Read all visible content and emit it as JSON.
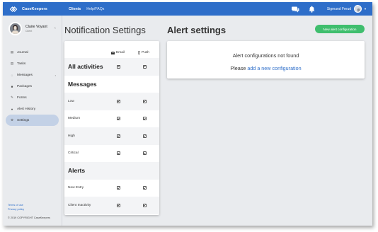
{
  "app": {
    "logo_text": "CaseKeepers",
    "nav": [
      "Clients",
      "Help/FAQs"
    ],
    "user_name": "Sigmund Freud"
  },
  "sidebar": {
    "profile_name": "Claire Voyant",
    "profile_role": "Client",
    "collapse_icon": "chevron-left-icon",
    "items": [
      {
        "label": "Journal",
        "icon": "journal-icon"
      },
      {
        "label": "Tasks",
        "icon": "tasks-icon"
      },
      {
        "label": "Messages",
        "icon": "messages-icon"
      },
      {
        "label": "Packages",
        "icon": "packages-icon"
      },
      {
        "label": "Forms",
        "icon": "forms-icon"
      },
      {
        "label": "Alert History",
        "icon": "alert-history-icon"
      },
      {
        "label": "Settings",
        "icon": "settings-icon"
      }
    ],
    "active_item": "Settings",
    "footer_links": [
      "Terms of use",
      "Privacy policy"
    ],
    "copyright": "© 2019 COPYRIGHT CaseKeepers"
  },
  "notification_settings": {
    "title": "Notification Settings",
    "col_email": "Email",
    "col_push": "Push",
    "rows": [
      {
        "label": "All activities",
        "email": true,
        "push": true
      },
      {
        "label": "Messages"
      },
      {
        "label": "Low",
        "email": true,
        "push": true
      },
      {
        "label": "Medium",
        "email": true,
        "push": true
      },
      {
        "label": "High",
        "email": true,
        "push": true
      },
      {
        "label": "Critical",
        "email": true,
        "push": true
      },
      {
        "label": "Alerts"
      },
      {
        "label": "New Entry",
        "email": true,
        "push": true
      },
      {
        "label": "Client Inactivity",
        "email": true,
        "push": true
      }
    ]
  },
  "alert_settings": {
    "title": "Alert settings",
    "new_button": "New alert configuration",
    "not_found": "Alert configurations not found",
    "please_prefix": "Please",
    "add_link": "add a new configuration"
  },
  "colors": {
    "brand": "#2e6ec9",
    "button_green": "#3fbe6e",
    "active_menu": "#c3d1e6"
  }
}
